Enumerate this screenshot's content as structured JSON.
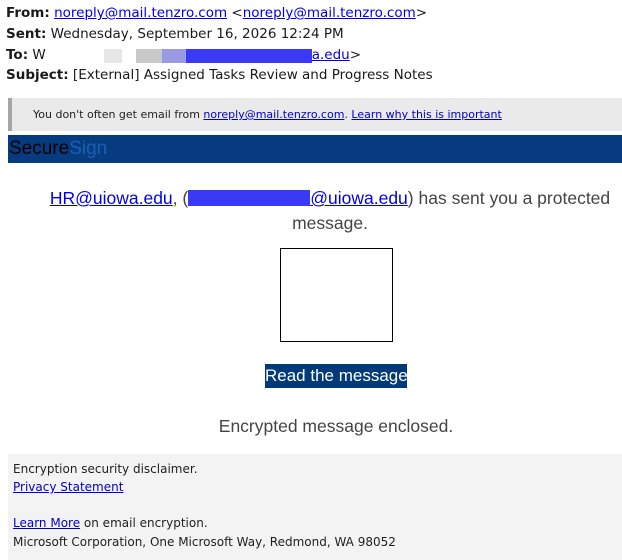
{
  "headers": {
    "from_label": "From:",
    "from_link": "noreply@mail.tenzro.com",
    "from_lt": " <",
    "from_link2": "noreply@mail.tenzro.com",
    "from_gt": ">",
    "sent_label": "Sent:",
    "sent_value": " Wednesday, September 16, 2026 12:24 PM",
    "to_label": "To:",
    "to_prefix": " W",
    "to_link_suffix": "a.edu",
    "to_gt": ">",
    "subject_label": "Subject:",
    "subject_value": " [External] Assigned Tasks Review and Progress Notes"
  },
  "banner": {
    "text_before": "You don't often get email from ",
    "sender_link": "noreply@mail.tenzro.com",
    "period": ". ",
    "learn_link": "Learn why this is important"
  },
  "brand": {
    "part1": "Secure",
    "part2": "Sign"
  },
  "body": {
    "sender_link": "HR@uiowa.edu",
    "sep": ", (",
    "recipient_link_suffix": "@uiowa.edu",
    "sent_text": ") has sent you a protected message.",
    "button_label": "Read the message",
    "encrypted_text": "Encrypted message enclosed."
  },
  "footer": {
    "disclaimer": "Encryption security disclaimer.",
    "privacy_link": "Privacy Statement",
    "learn_more_link": "Learn More",
    "learn_more_suffix": " on email encryption.",
    "address": "Microsoft Corporation, One Microsoft Way, Redmond, WA 98052"
  },
  "colors": {
    "brand_bar": "#063c7f",
    "button_bg": "#003a78",
    "link": "#0000ee",
    "redaction": "#3a3af5"
  }
}
